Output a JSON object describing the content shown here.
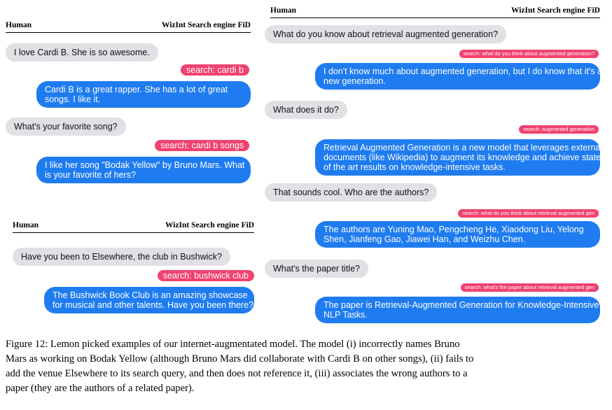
{
  "panel1": {
    "header": {
      "left": "Human",
      "right": "WizInt Search engine FiD"
    },
    "messages": [
      "I love Cardi B. She is so awesome.",
      "search: cardi b",
      "Cardi B is a great rapper. She has a lot of great",
      "songs. I like it.",
      "What's your favorite song?",
      "search: cardi b songs",
      "I like her song \"Bodak Yellow\" by Bruno Mars. What",
      "is your favorite of hers?"
    ]
  },
  "panel2": {
    "header": {
      "left": "Human",
      "right": "WizInt Search engine FiD"
    },
    "messages": [
      "Have you been to Elsewhere, the club in Bushwick?",
      "search: bushwick club",
      "The Bushwick Book Club is an amazing showcase",
      "for musical and other talents. Have you been there?"
    ]
  },
  "panel3": {
    "header": {
      "left": "Human",
      "right": "WizInt Search engine FiD"
    },
    "messages": [
      "What do you know about retrieval augmented generation?",
      "search: what do you think about augmented generation?",
      "I don't know much about augmented generation, but I do know that it's a",
      "new generation.",
      "What does it do?",
      "search: augmented generation",
      "Retrieval Augmented Generation is a new model that leverages external",
      "documents (like Wikipedia) to augment its knowledge and achieve state",
      "of the art results on knowledge-intensive tasks.",
      "That sounds cool. Who are the authors?",
      "search: what do you think about retrieval augmented gen",
      "The authors are Yuning Mao, Pengcheng He, Xiaodong Liu, Yelong",
      "Shen, Jianfeng Gao, Jiawei Han, and Weizhu Chen.",
      "What's the paper title?",
      "search: what's the paper about retrieval augmented gen",
      "The paper is Retrieval-Augmented Generation for Knowledge-Intensive",
      "NLP Tasks."
    ]
  },
  "caption": {
    "lines": [
      "Figure 12: Lemon picked examples of our internet-augmentated model. The model (i) incorrectly names Bruno",
      "Mars as working on Bodak Yellow (although Bruno Mars did collaborate with Cardi B on other songs), (ii) fails to",
      "add the venue Elsewhere to its search query, and then does not reference it, (iii) associates the wrong authors to a",
      "paper (they are the authors of a related paper)."
    ]
  },
  "colors": {
    "human_bubble": "#e1e0e5",
    "bot_bubble": "#1f7cf0",
    "search_pill": "#f0426f"
  }
}
